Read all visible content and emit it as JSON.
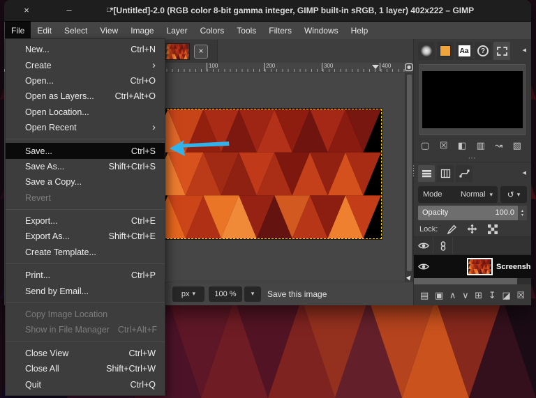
{
  "colors": {
    "arrow": "#2fb3ea",
    "selection_dash": "#ffd400",
    "titlebar_bg": "#1e1e1e",
    "window_bg": "#454545",
    "popup_bg": "#3d3d3d",
    "highlight_bg": "#0a0a0a",
    "dock_bg": "#383838"
  },
  "window": {
    "title": "*[Untitled]-2.0 (RGB color 8-bit gamma integer, GIMP built-in sRGB, 1 layer) 402x222 – GIMP",
    "controls": {
      "close": "×",
      "minimize": "–",
      "maximize": "□"
    }
  },
  "menubar": {
    "items": [
      "File",
      "Edit",
      "Select",
      "View",
      "Image",
      "Layer",
      "Colors",
      "Tools",
      "Filters",
      "Windows",
      "Help"
    ],
    "active_index": 0
  },
  "file_menu": {
    "items": [
      {
        "label": "New...",
        "shortcut": "Ctrl+N"
      },
      {
        "label": "Create",
        "submenu": true
      },
      {
        "label": "Open...",
        "shortcut": "Ctrl+O"
      },
      {
        "label": "Open as Layers...",
        "shortcut": "Ctrl+Alt+O"
      },
      {
        "label": "Open Location..."
      },
      {
        "label": "Open Recent",
        "submenu": true
      },
      {
        "separator": true
      },
      {
        "label": "Save...",
        "shortcut": "Ctrl+S",
        "selected": true
      },
      {
        "label": "Save As...",
        "shortcut": "Shift+Ctrl+S"
      },
      {
        "label": "Save a Copy..."
      },
      {
        "label": "Revert",
        "disabled": true
      },
      {
        "separator": true
      },
      {
        "label": "Export...",
        "shortcut": "Ctrl+E"
      },
      {
        "label": "Export As...",
        "shortcut": "Shift+Ctrl+E"
      },
      {
        "label": "Create Template..."
      },
      {
        "separator": true
      },
      {
        "label": "Print...",
        "shortcut": "Ctrl+P"
      },
      {
        "label": "Send by Email..."
      },
      {
        "separator": true
      },
      {
        "label": "Copy Image Location",
        "disabled": true
      },
      {
        "label": "Show in File Manager",
        "shortcut": "Ctrl+Alt+F",
        "disabled": true
      },
      {
        "separator": true
      },
      {
        "label": "Close View",
        "shortcut": "Ctrl+W"
      },
      {
        "label": "Close All",
        "shortcut": "Shift+Ctrl+W"
      },
      {
        "label": "Quit",
        "shortcut": "Ctrl+Q"
      }
    ]
  },
  "canvas": {
    "tab_close": "×",
    "ruler_labels": [
      "100",
      "200",
      "300",
      "400"
    ],
    "statusbar": {
      "unit": "px",
      "zoom": "100 %",
      "message": "Save this image"
    }
  },
  "selection_editor": {
    "tabs": [
      "brushes-icon",
      "patterns-icon",
      "fonts-icon",
      "pointer-icon",
      "selection-icon"
    ],
    "active_tab_index": 4,
    "fonts_glyph": "Aa",
    "help_glyph": "?",
    "buttons": [
      "select-all-icon",
      "select-none-icon",
      "invert-selection-icon",
      "save-to-channel-icon",
      "path-from-selection-icon",
      "stroke-selection-icon"
    ]
  },
  "layers_panel": {
    "tabs": [
      "layers-icon",
      "channels-icon",
      "paths-icon"
    ],
    "active_tab_index": 0,
    "mode_label": "Mode",
    "mode_value": "Normal",
    "opacity_label": "Opacity",
    "opacity_value": "100.0",
    "lock_label": "Lock:",
    "lock_icons": [
      "paintbrush-icon",
      "move-icon",
      "alpha-icon"
    ],
    "layer": {
      "name": "Screensho"
    },
    "buttons": [
      "new-layer-icon",
      "new-group-icon",
      "raise-layer-icon",
      "lower-layer-icon",
      "duplicate-layer-icon",
      "merge-layer-icon",
      "mask-layer-icon",
      "delete-layer-icon"
    ]
  },
  "wallpaper_rows": [
    [
      "#3f0d1a",
      "#54101f",
      "#451222",
      "#2f0e22",
      "#5a1422",
      "#6e1824",
      "#591020",
      "#721a23",
      "#83201f",
      "#5c1220",
      "#471019",
      "#8c2a1e",
      "#a33920",
      "#6b1a1c",
      "#4a0f16"
    ],
    [
      "#2c0e24",
      "#3d1129",
      "#55132a",
      "#471128",
      "#661627",
      "#7b1d26",
      "#8a2426",
      "#6e1822",
      "#932c22",
      "#7e1f20",
      "#5e1520",
      "#b14020",
      "#c6511f",
      "#8c241c",
      "#5a1219"
    ],
    [
      "#1e0d2a",
      "#33102e",
      "#45122c",
      "#2a0f2b",
      "#551428",
      "#6b1926",
      "#7c2026",
      "#5f1523",
      "#8c2820",
      "#a1341f",
      "#702527",
      "#c24b1e",
      "#d65a1e",
      "#93301e",
      "#40121f"
    ],
    [
      "#140a24",
      "#241030",
      "#3a1230",
      "#1d0c26",
      "#4c1328",
      "#5e1726",
      "#6f1c24",
      "#521424",
      "#7e2320",
      "#94301e",
      "#63202a",
      "#b4431e",
      "#ca521d",
      "#86281c",
      "#33101c"
    ]
  ],
  "image_rows": [
    [
      "#e0682a",
      "#c74419",
      "#93200f",
      "#aa2b15",
      "#7c180f",
      "#9e2413",
      "#b23118",
      "#8e1d10",
      "#701410",
      "#a52817",
      "#8a1b11",
      "#781710"
    ],
    [
      "#ec7c2f",
      "#d8521e",
      "#bb3a17",
      "#a02a13",
      "#8e2112",
      "#c03a1a",
      "#aa2d15",
      "#7e180f",
      "#c4401b",
      "#932112",
      "#d4511e",
      "#a82b14"
    ],
    [
      "#e5661f",
      "#cc4519",
      "#b03015",
      "#ea7526",
      "#f18a38",
      "#962213",
      "#641310",
      "#d25a20",
      "#b63617",
      "#8c1d11",
      "#ef8030",
      "#c23d18"
    ]
  ]
}
